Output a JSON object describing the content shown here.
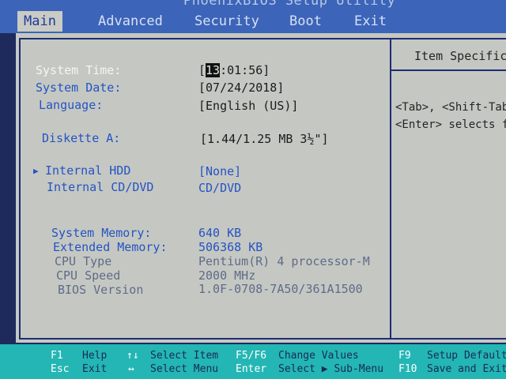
{
  "header": {
    "title": "PhoenixBIOS Setup Utility",
    "tabs": [
      {
        "label": "Main",
        "active": true
      },
      {
        "label": "Advanced",
        "active": false
      },
      {
        "label": "Security",
        "active": false
      },
      {
        "label": "Boot",
        "active": false
      },
      {
        "label": "Exit",
        "active": false
      }
    ]
  },
  "settings": {
    "system_time": {
      "label": "System Time:",
      "cursor": "13",
      "rest": ":01:56]",
      "open": "["
    },
    "system_date": {
      "label": "System Date:",
      "value": "[07/24/2018]"
    },
    "language": {
      "label": "Language:",
      "value": "[English  (US)]"
    },
    "diskette_a": {
      "label": "Diskette A:",
      "value": "[1.44/1.25 MB  3½\"]"
    },
    "internal_hdd": {
      "label": "Internal HDD",
      "value": "[None]"
    },
    "internal_cd": {
      "label": "Internal CD/DVD",
      "value": "CD/DVD"
    },
    "system_memory": {
      "label": "System Memory:",
      "value": "640 KB"
    },
    "extended_memory": {
      "label": "Extended Memory:",
      "value": "506368 KB"
    },
    "cpu_type": {
      "label": "CPU Type",
      "value": "Pentium(R) 4 processor-M"
    },
    "cpu_speed": {
      "label": "CPU Speed",
      "value": "2000 MHz"
    },
    "bios_version": {
      "label": "BIOS Version",
      "value": "1.0F-0708-7A50/361A1500"
    }
  },
  "help": {
    "title": "Item Specific",
    "line1": "<Tab>, <Shift-Tab",
    "line2": "<Enter> selects f"
  },
  "status_bar": {
    "row1": {
      "k1": "F1",
      "d1": "Help",
      "k2": "↑↓",
      "d2": "Select Item",
      "k3": "F5/F6",
      "d3": "Change Values",
      "k4": "F9",
      "d4": "Setup Default"
    },
    "row2": {
      "k1": "Esc",
      "d1": "Exit",
      "k2": "↔",
      "d2": "Select Menu",
      "k3": "Enter",
      "d3": "Select ▶ Sub-Menu",
      "k4": "F10",
      "d4": "Save and Exit"
    }
  },
  "colors": {
    "menu_bar": "#3c64b8",
    "panel": "#c5c8c2",
    "label_blue": "#2553c4",
    "status_bar": "#23b6b4"
  }
}
